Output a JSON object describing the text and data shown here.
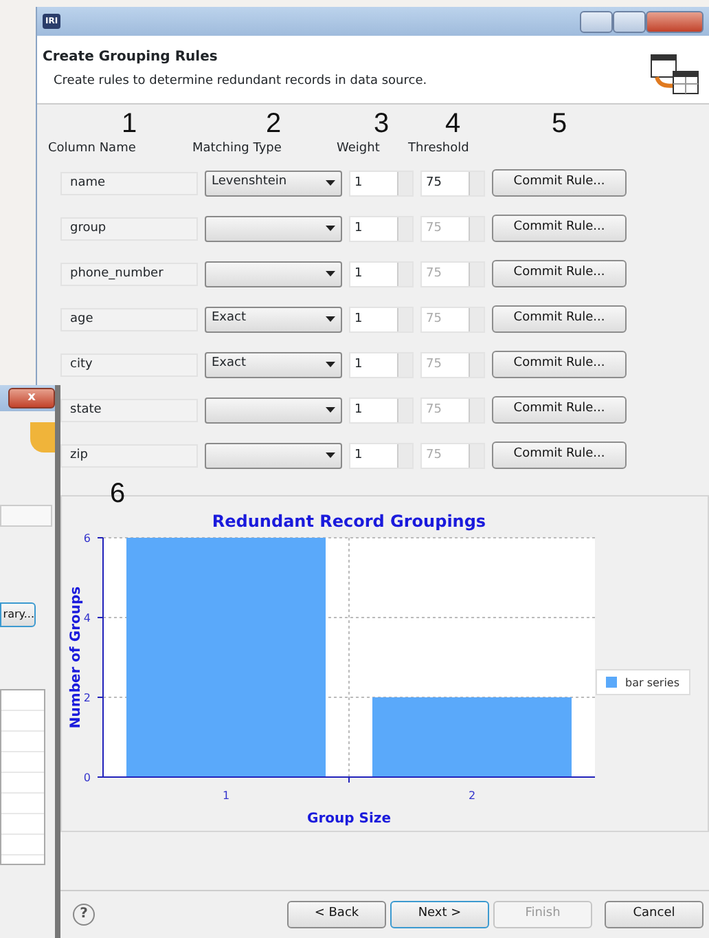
{
  "window": {
    "logo": "IRI",
    "title": "Create Grouping Rules",
    "description": "Create rules to determine redundant records in data source."
  },
  "callouts": [
    "1",
    "2",
    "3",
    "4",
    "5"
  ],
  "columns": [
    "Column Name",
    "Matching Type",
    "Weight",
    "Threshold"
  ],
  "rows": [
    {
      "column_name": "name",
      "matching_type": "Levenshtein",
      "weight": "1",
      "threshold": "75",
      "threshold_disabled": false,
      "button": "Commit Rule..."
    },
    {
      "column_name": "group",
      "matching_type": "",
      "weight": "1",
      "threshold": "75",
      "threshold_disabled": true,
      "button": "Commit Rule..."
    },
    {
      "column_name": "phone_number",
      "matching_type": "",
      "weight": "1",
      "threshold": "75",
      "threshold_disabled": true,
      "button": "Commit Rule..."
    },
    {
      "column_name": "age",
      "matching_type": "Exact",
      "weight": "1",
      "threshold": "75",
      "threshold_disabled": true,
      "button": "Commit Rule..."
    },
    {
      "column_name": "city",
      "matching_type": "Exact",
      "weight": "1",
      "threshold": "75",
      "threshold_disabled": true,
      "button": "Commit Rule..."
    },
    {
      "column_name": "state",
      "matching_type": "",
      "weight": "1",
      "threshold": "75",
      "threshold_disabled": true,
      "button": "Commit Rule..."
    },
    {
      "column_name": "zip",
      "matching_type": "",
      "weight": "1",
      "threshold": "75",
      "threshold_disabled": true,
      "button": "Commit Rule..."
    }
  ],
  "chart_panel": {
    "callout": "6",
    "chart_data": {
      "type": "bar",
      "title": "Redundant Record Groupings",
      "xlabel": "Group Size",
      "ylabel": "Number of Groups",
      "categories": [
        "1",
        "2"
      ],
      "series": [
        {
          "name": "bar series",
          "color": "#5aa9fa",
          "values": [
            6,
            2
          ]
        }
      ],
      "ylim": [
        0,
        6
      ],
      "yticks": [
        0,
        2,
        4,
        6
      ]
    }
  },
  "footer": {
    "help": "?",
    "buttons": [
      {
        "label": "< Back",
        "disabled": false,
        "default": false
      },
      {
        "label": "Next >",
        "disabled": false,
        "default": true
      },
      {
        "label": "Finish",
        "disabled": true,
        "default": false
      },
      {
        "label": "Cancel",
        "disabled": false,
        "default": false
      }
    ]
  },
  "background_window": {
    "close": "x",
    "button": "rary..."
  }
}
